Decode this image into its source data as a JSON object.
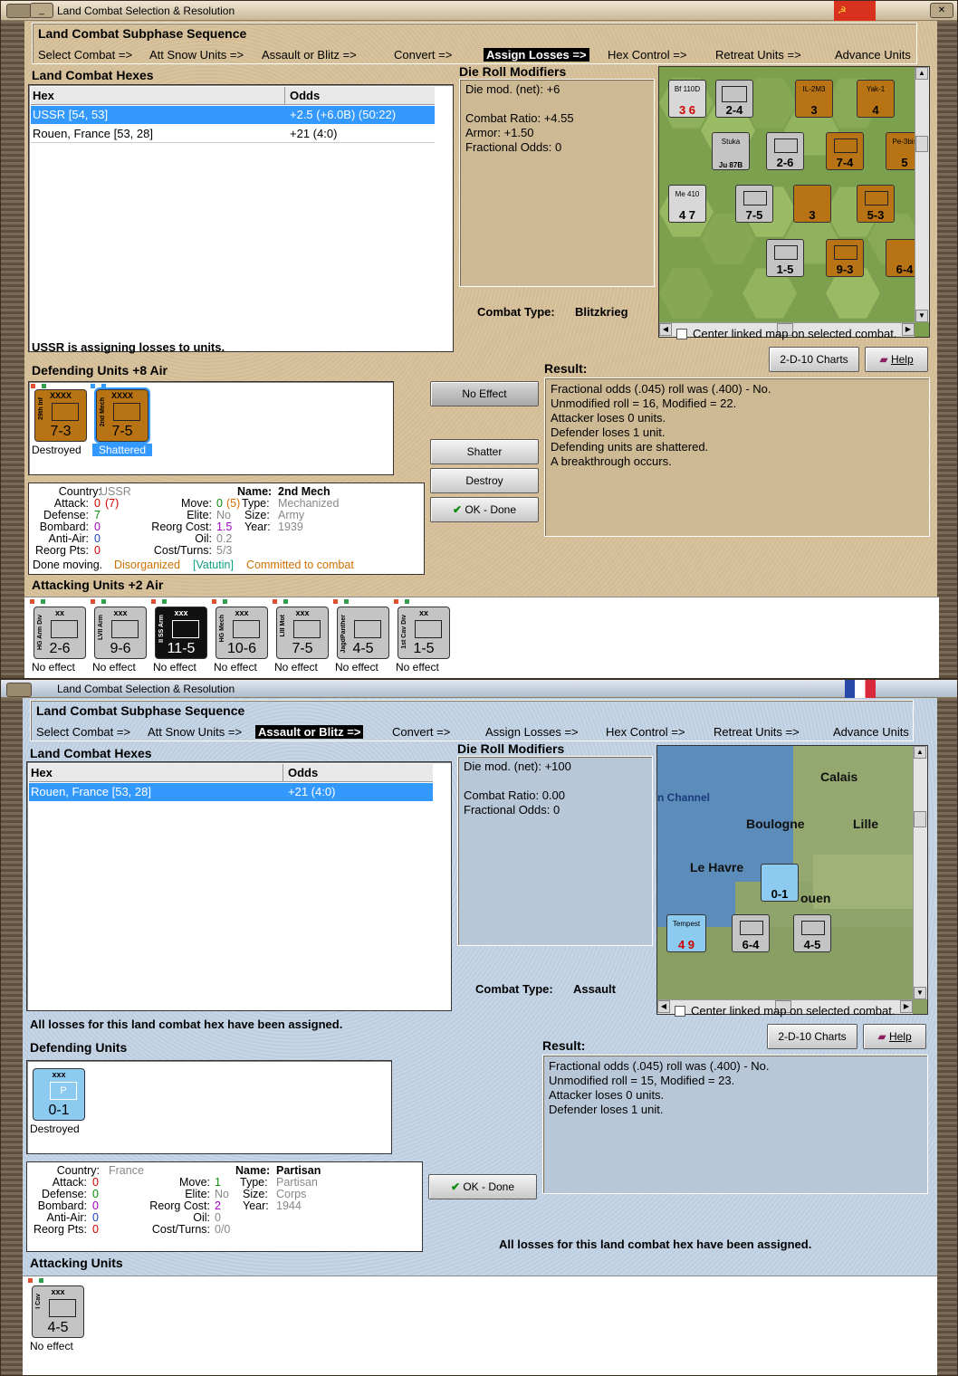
{
  "colors": {
    "accent_selected": "#3399ff",
    "parchment": "#d9c4a0",
    "paper_blue": "#c3d3e4",
    "counter_soviet": "#b87414",
    "counter_axis": "#c4c4c4",
    "counter_ss": "#111111",
    "counter_partisan": "#8ccaf0"
  },
  "window1": {
    "title": "Land Combat Selection & Resolution",
    "flag_text": "☭",
    "sequence": {
      "title": "Land Combat Subphase Sequence",
      "steps": [
        "Select Combat =>",
        "Att Snow Units =>",
        "Assault or Blitz =>",
        "Convert =>",
        "Assign Losses =>",
        "Hex Control =>",
        "Retreat Units =>",
        "Advance Units"
      ],
      "active_step": "Assign Losses =>"
    },
    "hexes_label": "Land Combat Hexes",
    "hex_table": {
      "headers": [
        "Hex",
        "Odds"
      ],
      "rows": [
        {
          "hex": "USSR [54, 53]",
          "odds": "+2.5 (+6.0B) (50:22)",
          "selected": true
        },
        {
          "hex": "Rouen, France [53, 28]",
          "odds": "+21 (4:0)",
          "selected": false
        }
      ]
    },
    "die_roll_label": "Die Roll Modifiers",
    "die_roll": [
      "Die mod. (net): +6",
      "",
      "Combat Ratio: +4.55",
      "Armor: +1.50",
      "Fractional Odds: 0"
    ],
    "combat_type_label": "Combat Type:",
    "combat_type": "Blitzkrieg",
    "center_map_label": "Center linked map on selected combat.",
    "status_message": "USSR is assigning losses to units.",
    "defending_label": "Defending Units +8 Air",
    "defending_units": [
      {
        "name": "29th Inf",
        "size": "XXXX",
        "value": "7-3",
        "caption": "Destroyed",
        "selected": false
      },
      {
        "name": "2nd Mech",
        "size": "XXXX",
        "value": "7-5",
        "caption": "Shattered",
        "selected": true
      }
    ],
    "buttons": {
      "no_effect": "No Effect",
      "shatter": "Shatter",
      "destroy": "Destroy",
      "ok_done": "OK - Done",
      "charts": "2-D-10 Charts",
      "help": "Help"
    },
    "result_label": "Result:",
    "result_lines": [
      "Fractional odds (.045) roll was (.400)  - No.",
      "Unmodified roll = 16, Modified = 22.",
      "Attacker loses 0 units.",
      "Defender loses 1 unit.",
      "Defending units are shattered.",
      "A breakthrough occurs."
    ],
    "info": {
      "country_lbl": "Country:",
      "country": "USSR",
      "attack_lbl": "Attack:",
      "attack": "0",
      "attack_paren": "(7)",
      "defense_lbl": "Defense:",
      "defense": "7",
      "bombard_lbl": "Bombard:",
      "bombard": "0",
      "antiair_lbl": "Anti-Air:",
      "antiair": "0",
      "reorg_lbl": "Reorg Pts:",
      "reorg": "0",
      "move_lbl": "Move:",
      "move": "0",
      "move_paren": "(5)",
      "elite_lbl": "Elite:",
      "elite": "No",
      "reorgcost_lbl": "Reorg Cost:",
      "reorgcost": "1.5",
      "oil_lbl": "Oil:",
      "oil": "0.2",
      "costturns_lbl": "Cost/Turns:",
      "costturns": "5/3",
      "name_lbl": "Name:",
      "name": "2nd Mech",
      "type_lbl": "Type:",
      "type": "Mechanized",
      "size_lbl": "Size:",
      "size": "Army",
      "year_lbl": "Year:",
      "year": "1939",
      "status_a": "Done moving.",
      "status_b": "Disorganized",
      "status_c": "[Vatutin]",
      "status_d": "Committed to combat"
    },
    "attacking_label": "Attacking Units +2 Air",
    "attacking_units": [
      {
        "name": "HG Arm Div",
        "size": "xx",
        "value": "2-6",
        "caption": "No effect",
        "style": "gray"
      },
      {
        "name": "LVII Arm",
        "size": "xxx",
        "value": "9-6",
        "caption": "No effect",
        "style": "gray"
      },
      {
        "name": "II SS Arm",
        "size": "xxx",
        "value": "11-5",
        "caption": "No effect",
        "style": "black"
      },
      {
        "name": "HG Mech",
        "size": "xxx",
        "value": "10-6",
        "caption": "No effect",
        "style": "gray"
      },
      {
        "name": "LIII Mot",
        "size": "xxx",
        "value": "7-5",
        "caption": "No effect",
        "style": "gray"
      },
      {
        "name": "JagdPanther",
        "size": "",
        "value": "4-5",
        "caption": "No effect",
        "style": "gray"
      },
      {
        "name": "1st Cav Div",
        "size": "xx",
        "value": "1-5",
        "caption": "No effect",
        "style": "gray"
      }
    ],
    "map_labels": [
      "Bf 110D",
      "Yak-1",
      "Pe-3bis",
      "Stuka",
      "Ju 87B",
      "Me 410",
      "IL-2M3",
      "2-4",
      "2-6",
      "7-4",
      "7-5",
      "5-3",
      "1-5",
      "9-3",
      "6-4"
    ]
  },
  "window2": {
    "title": "Land Combat Selection & Resolution",
    "sequence": {
      "title": "Land Combat Subphase Sequence",
      "steps": [
        "Select Combat =>",
        "Att Snow Units =>",
        "Assault or Blitz =>",
        "Convert =>",
        "Assign Losses =>",
        "Hex Control =>",
        "Retreat Units =>",
        "Advance Units"
      ],
      "active_step": "Assault or Blitz =>"
    },
    "hexes_label": "Land Combat Hexes",
    "hex_table": {
      "headers": [
        "Hex",
        "Odds"
      ],
      "rows": [
        {
          "hex": "Rouen, France [53, 28]",
          "odds": "+21 (4:0)",
          "selected": true
        }
      ]
    },
    "die_roll_label": "Die Roll Modifiers",
    "die_roll": [
      "Die mod. (net): +100",
      "",
      "Combat Ratio: 0.00",
      "Fractional Odds: 0"
    ],
    "combat_type_label": "Combat Type:",
    "combat_type": "Assault",
    "center_map_label": "Center linked map on selected combat.",
    "status_message": "All losses for this land combat hex have been assigned.",
    "defending_label": "Defending Units",
    "defending_units": [
      {
        "name": "P",
        "size": "xxx",
        "value": "0-1",
        "caption": "Destroyed"
      }
    ],
    "buttons": {
      "ok_done": "OK - Done",
      "charts": "2-D-10 Charts",
      "help": "Help"
    },
    "result_label": "Result:",
    "result_lines": [
      "Fractional odds (.045) roll was (.400)  - No.",
      "Unmodified roll = 15, Modified = 23.",
      "Attacker loses 0 units.",
      "Defender loses 1 unit."
    ],
    "bottom_message": "All losses for this land combat hex have been assigned.",
    "info": {
      "country_lbl": "Country:",
      "country": "France",
      "attack_lbl": "Attack:",
      "attack": "0",
      "defense_lbl": "Defense:",
      "defense": "0",
      "bombard_lbl": "Bombard:",
      "bombard": "0",
      "antiair_lbl": "Anti-Air:",
      "antiair": "0",
      "reorg_lbl": "Reorg Pts:",
      "reorg": "0",
      "move_lbl": "Move:",
      "move": "1",
      "elite_lbl": "Elite:",
      "elite": "No",
      "reorgcost_lbl": "Reorg Cost:",
      "reorgcost": "2",
      "oil_lbl": "Oil:",
      "oil": "0",
      "costturns_lbl": "Cost/Turns:",
      "costturns": "0/0",
      "name_lbl": "Name:",
      "name": "Partisan",
      "type_lbl": "Type:",
      "type": "Partisan",
      "size_lbl": "Size:",
      "size": "Corps",
      "year_lbl": "Year:",
      "year": "1944"
    },
    "attacking_label": "Attacking Units",
    "attacking_units": [
      {
        "name": "I Cav",
        "size": "xxx",
        "value": "4-5",
        "caption": "No effect"
      }
    ],
    "map_labels": {
      "calais": "Calais",
      "channel": "n Channel",
      "boulogne": "Boulogne",
      "lille": "Lille",
      "le_havre": "Le Havre",
      "rouen": "ouen",
      "tempest": "Tempest",
      "c1": "0-1",
      "c2": "6-4",
      "c3": "4-5"
    }
  }
}
